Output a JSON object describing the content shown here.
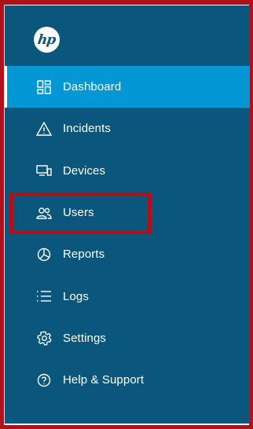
{
  "app": {
    "logo_text": "hp"
  },
  "sidebar": {
    "items": [
      {
        "label": "Dashboard",
        "icon": "dashboard-icon",
        "active": true
      },
      {
        "label": "Incidents",
        "icon": "warning-icon",
        "active": false
      },
      {
        "label": "Devices",
        "icon": "devices-icon",
        "active": false
      },
      {
        "label": "Users",
        "icon": "users-icon",
        "active": false
      },
      {
        "label": "Reports",
        "icon": "pie-chart-icon",
        "active": false
      },
      {
        "label": "Logs",
        "icon": "list-icon",
        "active": false
      },
      {
        "label": "Settings",
        "icon": "gear-icon",
        "active": false
      },
      {
        "label": "Help & Support",
        "icon": "help-icon",
        "active": false
      }
    ]
  },
  "colors": {
    "sidebar_bg": "#0b567d",
    "active_bg": "#0397d6",
    "annotation_red": "#b0101a"
  }
}
